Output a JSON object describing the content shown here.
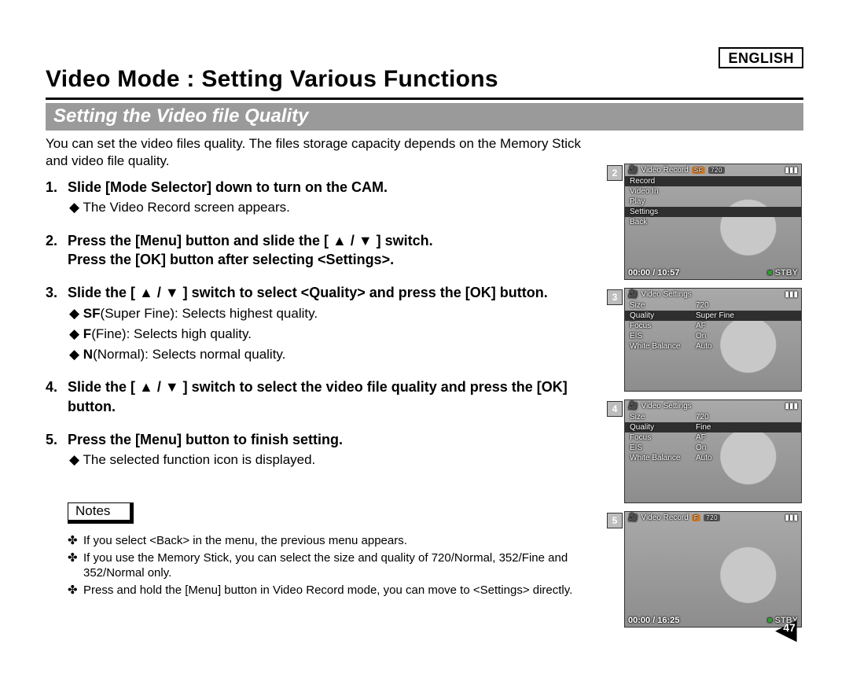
{
  "language_badge": "ENGLISH",
  "page_title": "Video Mode : Setting Various Functions",
  "section_heading": "Setting the Video file Quality",
  "intro_text": "You can set the video files quality. The files storage capacity depends on the Memory Stick and video file quality.",
  "steps": [
    {
      "num": "1.",
      "head": "Slide [Mode Selector] down to turn on the CAM.",
      "subs": [
        "The Video Record screen appears."
      ]
    },
    {
      "num": "2.",
      "head": "Press the [Menu] button and slide the [ ▲ / ▼ ] switch.\nPress the [OK] button after selecting <Settings>.",
      "subs": []
    },
    {
      "num": "3.",
      "head": "Slide the [ ▲ / ▼ ] switch to select <Quality> and press the [OK] button.",
      "subs": [
        "SF(Super Fine): Selects highest quality.",
        "F(Fine): Selects high quality.",
        "N(Normal): Selects normal quality."
      ],
      "sub_bold_prefix": [
        "SF",
        "F",
        "N"
      ]
    },
    {
      "num": "4.",
      "head": "Slide the [ ▲ / ▼ ] switch to select the video file quality and press the [OK] button.",
      "subs": []
    },
    {
      "num": "5.",
      "head": "Press the [Menu] button to finish setting.",
      "subs": [
        "The selected function icon is displayed."
      ]
    }
  ],
  "notes_label": "Notes",
  "notes": [
    "If you select <Back> in the menu, the previous menu appears.",
    "If you use the Memory Stick, you can select the size and quality of 720/Normal, 352/Fine and 352/Normal only.",
    "Press and hold the [Menu] button in Video Record mode, you can move to <Settings> directly."
  ],
  "page_number": "47",
  "lcd": {
    "screens": [
      {
        "num": "2",
        "title": "Video Record",
        "pills": [
          "SF",
          "720"
        ],
        "menu": [
          {
            "label": "Record",
            "sel": "dark"
          },
          {
            "label": "Video In"
          },
          {
            "label": "Play"
          },
          {
            "label": "Settings",
            "sel": "dark"
          },
          {
            "label": "Back"
          }
        ],
        "footer_left": "00:00 / 10:57",
        "footer_right": "STBY"
      },
      {
        "num": "3",
        "title": "Video Settings",
        "menu": [
          {
            "label": "Size",
            "value": "720"
          },
          {
            "label": "Quality",
            "value": "Super Fine",
            "sel": "dark"
          },
          {
            "label": "Focus",
            "value": "AF"
          },
          {
            "label": "EIS",
            "value": "On"
          },
          {
            "label": "White Balance",
            "value": "Auto"
          }
        ]
      },
      {
        "num": "4",
        "title": "Video Settings",
        "menu": [
          {
            "label": "Size",
            "value": "720"
          },
          {
            "label": "Quality",
            "value": "Fine",
            "sel": "dark"
          },
          {
            "label": "Focus",
            "value": "AF"
          },
          {
            "label": "EIS",
            "value": "On"
          },
          {
            "label": "White Balance",
            "value": "Auto"
          }
        ]
      },
      {
        "num": "5",
        "title": "Video Record",
        "pills": [
          "F",
          "720"
        ],
        "menu": [],
        "footer_left": "00:00 / 16:25",
        "footer_right": "STBY"
      }
    ]
  }
}
